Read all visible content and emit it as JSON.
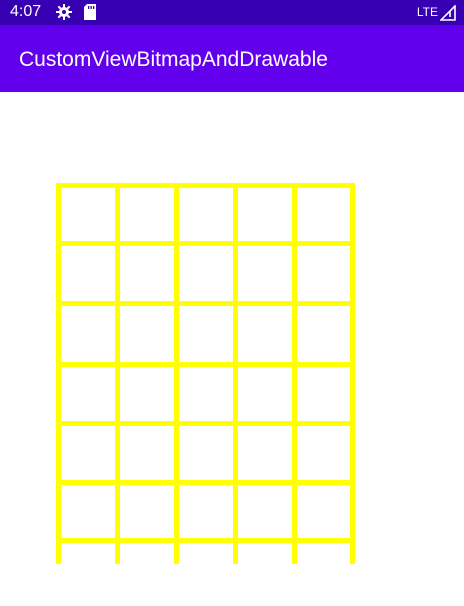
{
  "status_bar": {
    "time": "4:07",
    "network": "LTE",
    "icons": [
      "gear-icon",
      "sd-card-icon",
      "signal-icon"
    ]
  },
  "app_bar": {
    "title": "CustomViewBitmapAndDrawable",
    "color": "#6200ee"
  },
  "status_bar_color": "#3700b3",
  "grid": {
    "color": "#ffff00",
    "columns": 5,
    "rows": 6
  }
}
